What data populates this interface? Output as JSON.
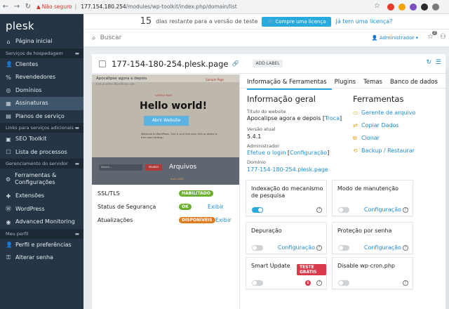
{
  "browser": {
    "insecure_label": "Não seguro",
    "url_host": "177.154.180.254",
    "url_path": "/modules/wp-toolkit/index.php/domain/list"
  },
  "sidebar": {
    "logo": "plesk",
    "items": [
      {
        "type": "item",
        "label": "Página inicial",
        "icon": "home-icon",
        "glyph": "⌂"
      },
      {
        "type": "head",
        "label": "Serviços de hospedagem"
      },
      {
        "type": "item",
        "label": "Clientes",
        "icon": "user-icon",
        "glyph": "👤"
      },
      {
        "type": "item",
        "label": "Revendedores",
        "icon": "percent-icon",
        "glyph": "%"
      },
      {
        "type": "item",
        "label": "Domínios",
        "icon": "globe-icon",
        "glyph": "◎"
      },
      {
        "type": "item",
        "label": "Assinaturas",
        "icon": "grid-icon",
        "glyph": "▦",
        "active": true
      },
      {
        "type": "item",
        "label": "Planos de serviço",
        "icon": "clipboard-icon",
        "glyph": "▤"
      },
      {
        "type": "head",
        "label": "Links para serviços adicionais"
      },
      {
        "type": "item",
        "label": "SEO Toolkit",
        "icon": "seo-icon",
        "glyph": "▣"
      },
      {
        "type": "item",
        "label": "Lista de processos",
        "icon": "list-icon",
        "glyph": "☐"
      },
      {
        "type": "head",
        "label": "Gerenciamento do servidor"
      },
      {
        "type": "item",
        "label": "Ferramentas & Configurações",
        "icon": "gear-icon",
        "glyph": "⚙",
        "tall": true
      },
      {
        "type": "item",
        "label": "Extensões",
        "icon": "puzzle-icon",
        "glyph": "✚"
      },
      {
        "type": "item",
        "label": "WordPress",
        "icon": "wordpress-icon",
        "glyph": "Ⓦ"
      },
      {
        "type": "item",
        "label": "Advanced Monitoring",
        "icon": "monitor-icon",
        "glyph": "◉"
      },
      {
        "type": "head",
        "label": "Meu perfil"
      },
      {
        "type": "item",
        "label": "Perfil e preferências",
        "icon": "profile-icon",
        "glyph": "👤"
      },
      {
        "type": "item",
        "label": "Alterar senha",
        "icon": "key-icon",
        "glyph": "⚿"
      }
    ]
  },
  "trial": {
    "days": "15",
    "text": "dias restante para a versão de teste",
    "buy_label": "Compre uma licença",
    "have_label": "Já tem uma licença?"
  },
  "search": {
    "placeholder": "Buscar"
  },
  "header": {
    "admin_label": "Administrador",
    "notif_count": "2"
  },
  "domain": {
    "name": "177-154-180-254.plesk.page",
    "add_label": "ADD LABEL"
  },
  "preview": {
    "site_title": "Apocalipse agora e depois",
    "tagline": "Just another WordPress site",
    "menu": "Sample Page",
    "sample": "SAMPLE PAGE",
    "hello": "Hello world!",
    "open_btn": "Abrir Website",
    "body_text": "Welcome to WordPress. This is your first post. Edit or delete it, then start writing!",
    "search_ph": "Search ...",
    "search_btn": "SEARCH",
    "archives": "Arquivos",
    "date": "maio 2020"
  },
  "statuses": [
    {
      "label": "SSL/TLS",
      "pill": "HABILITADO",
      "color": "#6ab02e",
      "action": ""
    },
    {
      "label": "Status de Segurança",
      "pill": "OK",
      "color": "#6ab02e",
      "action": "Exibir"
    },
    {
      "label": "Atualizações",
      "pill": "DISPONÍVEIS",
      "color": "#e07a1f",
      "action": "Exibir"
    }
  ],
  "tabs": [
    "Informação & Ferramentas",
    "Plugins",
    "Temas",
    "Banco de dados"
  ],
  "info": {
    "title": "Informação geral",
    "site_title_label": "Título do website",
    "site_title_value": "Apocalipse agora e depois",
    "site_title_action": "Troca",
    "version_label": "Versão atual",
    "version_value": "5.4.1",
    "admin_label": "Administrador",
    "admin_login": "Efetue o login",
    "admin_config": "Configuração",
    "domain_label": "Domínio",
    "domain_value": "177-154-180-254.plesk.page"
  },
  "tools": {
    "title": "Ferramentas",
    "items": [
      {
        "label": "Gerente de arquivo",
        "icon": "folder-icon",
        "glyph": "▭"
      },
      {
        "label": "Copiar Dados",
        "icon": "copy-icon",
        "glyph": "⇄"
      },
      {
        "label": "Clonar",
        "icon": "clone-icon",
        "glyph": "⧉"
      },
      {
        "label": "Backup / Restaurar",
        "icon": "backup-icon",
        "glyph": "⟲"
      }
    ]
  },
  "cards": [
    {
      "title": "Indexação do mecanismo de pesquisa",
      "on": true,
      "link": ""
    },
    {
      "title": "Modo de manutenção",
      "on": false,
      "link": "Configuração"
    },
    {
      "title": "Depuração",
      "on": false,
      "link": "Configuração"
    },
    {
      "title": "Proteção por senha",
      "on": false,
      "link": "Configuração"
    },
    {
      "title": "Smart Update",
      "on": false,
      "link": "",
      "tag": "TESTE GRÁTIS"
    },
    {
      "title": "Disable wp-cron.php",
      "on": false,
      "link": ""
    }
  ],
  "colors": {
    "accent": "#28aade",
    "sidebar": "#253545",
    "link": "#1f8dd6"
  }
}
